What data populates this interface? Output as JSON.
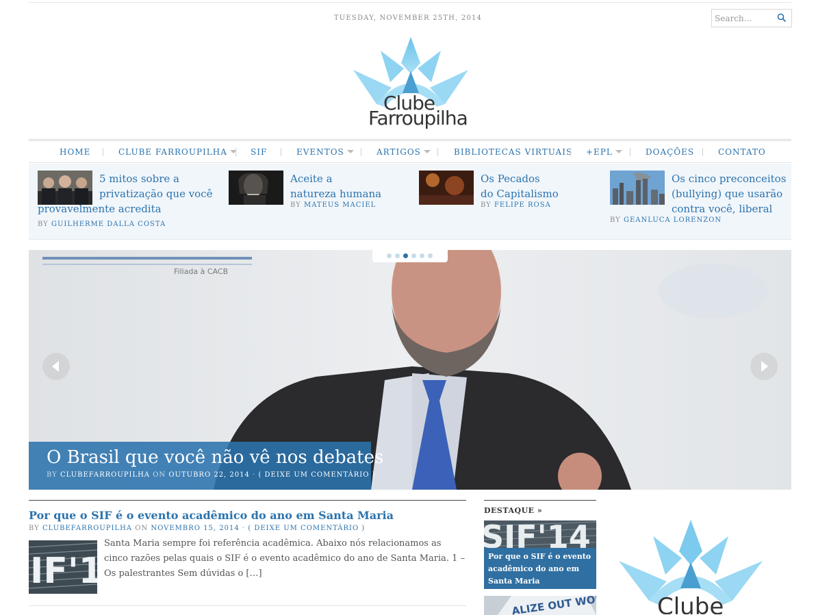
{
  "header": {
    "date": "TUESDAY, NOVEMBER 25TH, 2014",
    "search_placeholder": "Search...",
    "logo_line1": "Clube",
    "logo_line2": "Farroupilha",
    "accent_color": "#2b73ad",
    "logo_color": "#8fd3f2"
  },
  "nav": {
    "items": [
      {
        "label": "HOME",
        "dropdown": false
      },
      {
        "label": "CLUBE FARROUPILHA",
        "dropdown": true
      },
      {
        "label": "SIF",
        "dropdown": false
      },
      {
        "label": "EVENTOS",
        "dropdown": true
      },
      {
        "label": "ARTIGOS",
        "dropdown": true
      },
      {
        "label": "BIBLIOTECAS VIRTUAIS",
        "dropdown": false
      },
      {
        "label": "+EPL",
        "dropdown": true
      },
      {
        "label": "DOAÇÕES",
        "dropdown": false
      },
      {
        "label": "CONTATO",
        "dropdown": false
      }
    ]
  },
  "featured": [
    {
      "title_line1": "5 mitos sobre a",
      "title_line2": "privatização que você",
      "title_line3": "provavelmente acredita",
      "by": "BY",
      "author": "GUILHERME DALLA COSTA"
    },
    {
      "title_line1": "Aceite a",
      "title_line2": "natureza humana",
      "by": "BY",
      "author": "MATEUS MACIEL"
    },
    {
      "title_line1": "Os Pecados",
      "title_line2": "do Capitalismo",
      "by": "BY",
      "author": "FELIPE ROSA"
    },
    {
      "title_line1": "Os cinco preconceitos",
      "title_line2": "(bullying) que usarão",
      "title_line3": "contra você, liberal",
      "by": "BY",
      "author": "GEANLUCA LORENZON"
    }
  ],
  "slider": {
    "active_slide": 3,
    "slide_count": 6,
    "background_text": "Filiada à CACB",
    "caption_title": "O Brasil que você não vê nos debates",
    "by": "BY",
    "author": "CLUBEFARROUPILHA",
    "on": "ON",
    "date": "OUTUBRO 22, 2014",
    "separator": "·",
    "comments": "( DEIXE UM COMENTÁRIO )"
  },
  "post": {
    "title": "Por que o SIF é o evento acadêmico do ano em Santa Maria",
    "by": "BY",
    "author": "CLUBEFARROUPILHA",
    "on": "ON",
    "date": "NOVEMBRO 15, 2014",
    "separator": "·",
    "comments": "( DEIXE UM COMENTÁRIO )",
    "thumb_text": "IF'1",
    "excerpt": "Santa Maria sempre foi referência acadêmica. Abaixo nós relacionamos as cinco razões pelas quais o SIF é o evento acadêmico do ano de Santa Maria. 1 – Os palestrantes Sem dúvidas o […]"
  },
  "destaque": {
    "heading": "DESTAQUE »",
    "card_text": "SIF'14",
    "card_title": "Por que o SIF é o evento acadêmico do ano em Santa Maria",
    "card2_text": "ALIZE OUT WORL"
  },
  "sidebar": {
    "logo_text": "Clube"
  }
}
